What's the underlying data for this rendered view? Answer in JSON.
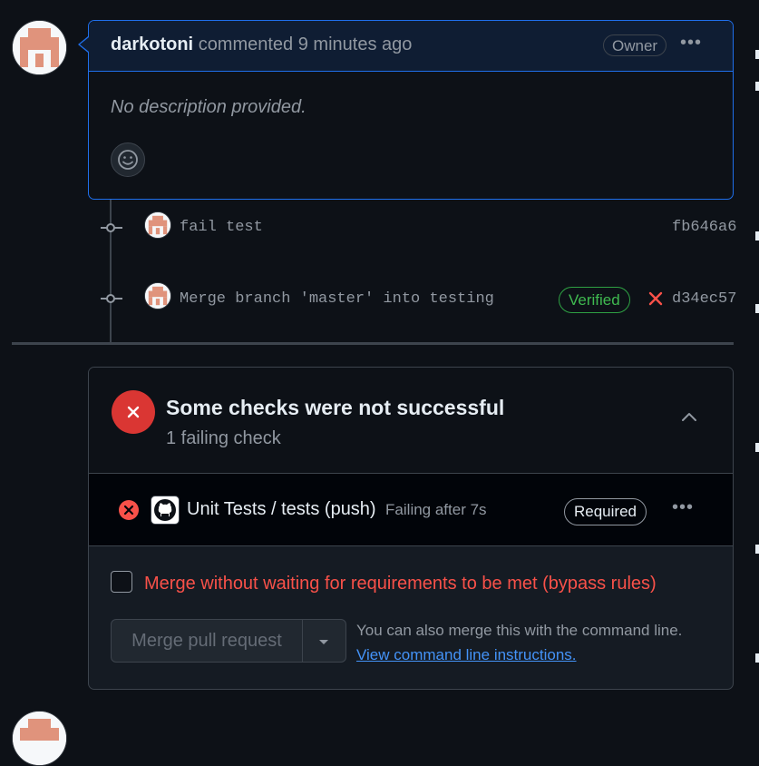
{
  "comment": {
    "author": "darkotoni",
    "action": "commented 9 minutes ago",
    "badge": "Owner",
    "body": "No description provided."
  },
  "commits": [
    {
      "message": "fail test",
      "sha": "fb646a6"
    },
    {
      "message": "Merge branch 'master' into testing",
      "badge": "Verified",
      "sha": "d34ec57"
    }
  ],
  "checks": {
    "title": "Some checks were not successful",
    "subtitle": "1 failing check",
    "item": {
      "name": "Unit Tests / tests (push)",
      "status": "Failing after 7s",
      "badge": "Required"
    }
  },
  "merge": {
    "bypass_label": "Merge without waiting for requirements to be met (bypass rules)",
    "button_label": "Merge pull request",
    "cli_text": "You can also merge this with the command line.",
    "cli_link": "View command line instructions."
  },
  "colors": {
    "accent_blue": "#1f6feb",
    "danger": "#da3633",
    "success": "#3fb950",
    "link": "#4493f8"
  }
}
